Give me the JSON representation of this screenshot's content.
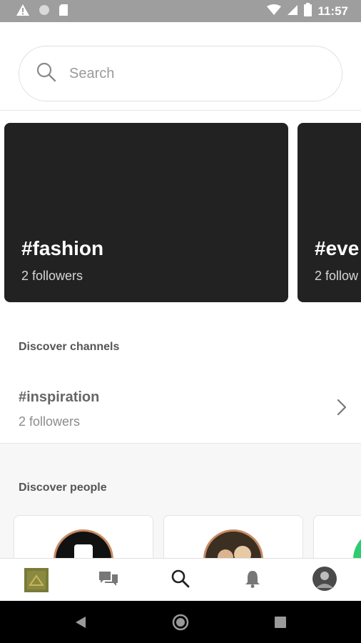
{
  "status_bar": {
    "time": "11:57"
  },
  "search": {
    "placeholder": "Search"
  },
  "featured_channels": [
    {
      "tag": "#fashion",
      "followers": "2 followers"
    },
    {
      "tag": "#eve",
      "followers": "2 follow"
    }
  ],
  "discover_channels": {
    "title": "Discover channels",
    "items": [
      {
        "name": "#inspiration",
        "followers": "2 followers"
      }
    ]
  },
  "discover_people": {
    "title": "Discover people"
  },
  "bottom_nav": {
    "items": [
      "home-thumbnail",
      "chat-icon",
      "search-icon",
      "bell-icon",
      "profile-avatar"
    ],
    "active": "search-icon"
  },
  "colors": {
    "card_bg": "#222222",
    "status_bar": "#9e9e9e",
    "avatar_ring": "#c98b63",
    "accent_green": "#2ecc71"
  }
}
